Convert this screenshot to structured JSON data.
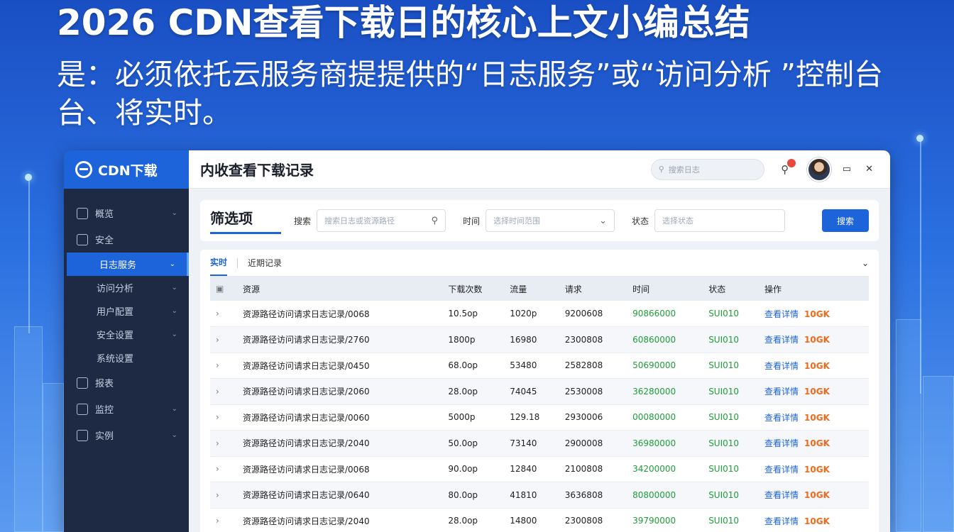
{
  "headline": "2026 CDN查看下载日的核心上文小编总结",
  "subline": "是：必须依托云服务商提提供的“日志服务”或“访问分析 ”控制台台、将实时。",
  "sidebar": {
    "brand": "CDN下载",
    "items": [
      {
        "label": "概览",
        "icon": "home-icon",
        "chevron": "⌄"
      },
      {
        "label": "安全",
        "icon": "shield-icon",
        "chevron": ""
      },
      {
        "label": "日志服务",
        "icon": "",
        "chevron": "⌄",
        "active": true,
        "sub": true
      },
      {
        "label": "访问分析",
        "icon": "",
        "chevron": "⌄",
        "sub": true
      },
      {
        "label": "用户配置",
        "icon": "",
        "chevron": "⌄",
        "sub": true
      },
      {
        "label": "安全设置",
        "icon": "",
        "chevron": "⌄",
        "sub": true
      },
      {
        "label": "系统设置",
        "icon": "",
        "chevron": "",
        "sub": true
      },
      {
        "label": "报表",
        "icon": "report-icon",
        "chevron": ""
      },
      {
        "label": "监控",
        "icon": "monitor-icon",
        "chevron": "⌄"
      },
      {
        "label": "实例",
        "icon": "server-icon",
        "chevron": "⌄"
      }
    ]
  },
  "topbar": {
    "title": "内收查看下载记录",
    "search_placeholder": "搜索日志",
    "window_controls": "▭ ✕"
  },
  "filter": {
    "title": "筛选项",
    "field1_label": "搜索",
    "field1_placeholder": "搜索日志或资源路径",
    "field2_label": "时间",
    "field2_placeholder": "选择时间范围",
    "field3_label": "状态",
    "field3_placeholder": "选择状态",
    "button": "搜索"
  },
  "tabs": {
    "items": [
      "实时",
      "近期记录"
    ],
    "collapse": "⌄"
  },
  "table": {
    "headers": [
      "▣",
      "资源",
      "下载次数",
      "流量",
      "请求",
      "时间",
      "状态",
      "操作"
    ],
    "rows": [
      [
        "›",
        "资源路径访问请求日志记录/0068",
        "10.5op",
        "1020p",
        "9200608",
        "90866000",
        "SUI010",
        "查看详情",
        "10GK"
      ],
      [
        "›",
        "资源路径访问请求日志记录/2760",
        "1800p",
        "16980",
        "2300808",
        "60860000",
        "SUI010",
        "查看详情",
        "10GK"
      ],
      [
        "›",
        "资源路径访问请求日志记录/0450",
        "68.0op",
        "53480",
        "2582808",
        "50690000",
        "SUI010",
        "查看详情",
        "10GK"
      ],
      [
        "›",
        "资源路径访问请求日志记录/2060",
        "28.0op",
        "74045",
        "2530008",
        "36280000",
        "SUI010",
        "查看详情",
        "10GK"
      ],
      [
        "›",
        "资源路径访问请求日志记录/0060",
        "5000p",
        "129.18",
        "2930006",
        "00080000",
        "SUI010",
        "查看详情",
        "10GK"
      ],
      [
        "›",
        "资源路径访问请求日志记录/2040",
        "50.0op",
        "73140",
        "2900008",
        "36980000",
        "SUI010",
        "查看详情",
        "10GK"
      ],
      [
        "›",
        "资源路径访问请求日志记录/0068",
        "90.0op",
        "12840",
        "2100808",
        "34200000",
        "SUI010",
        "查看详情",
        "10GK"
      ],
      [
        "›",
        "资源路径访问请求日志记录/0640",
        "80.0op",
        "41810",
        "3636808",
        "80800000",
        "SUI010",
        "查看详情",
        "10GK"
      ],
      [
        "›",
        "资源路径访问请求日志记录/2040",
        "28.0op",
        "14800",
        "2300808",
        "39790000",
        "SUI010",
        "查看详情",
        "10GK"
      ]
    ]
  },
  "colors": {
    "accent": "#1d63d9",
    "sidebar": "#1e2a44",
    "status_ok": "#1e9e3a",
    "badge": "#f06a1c"
  }
}
